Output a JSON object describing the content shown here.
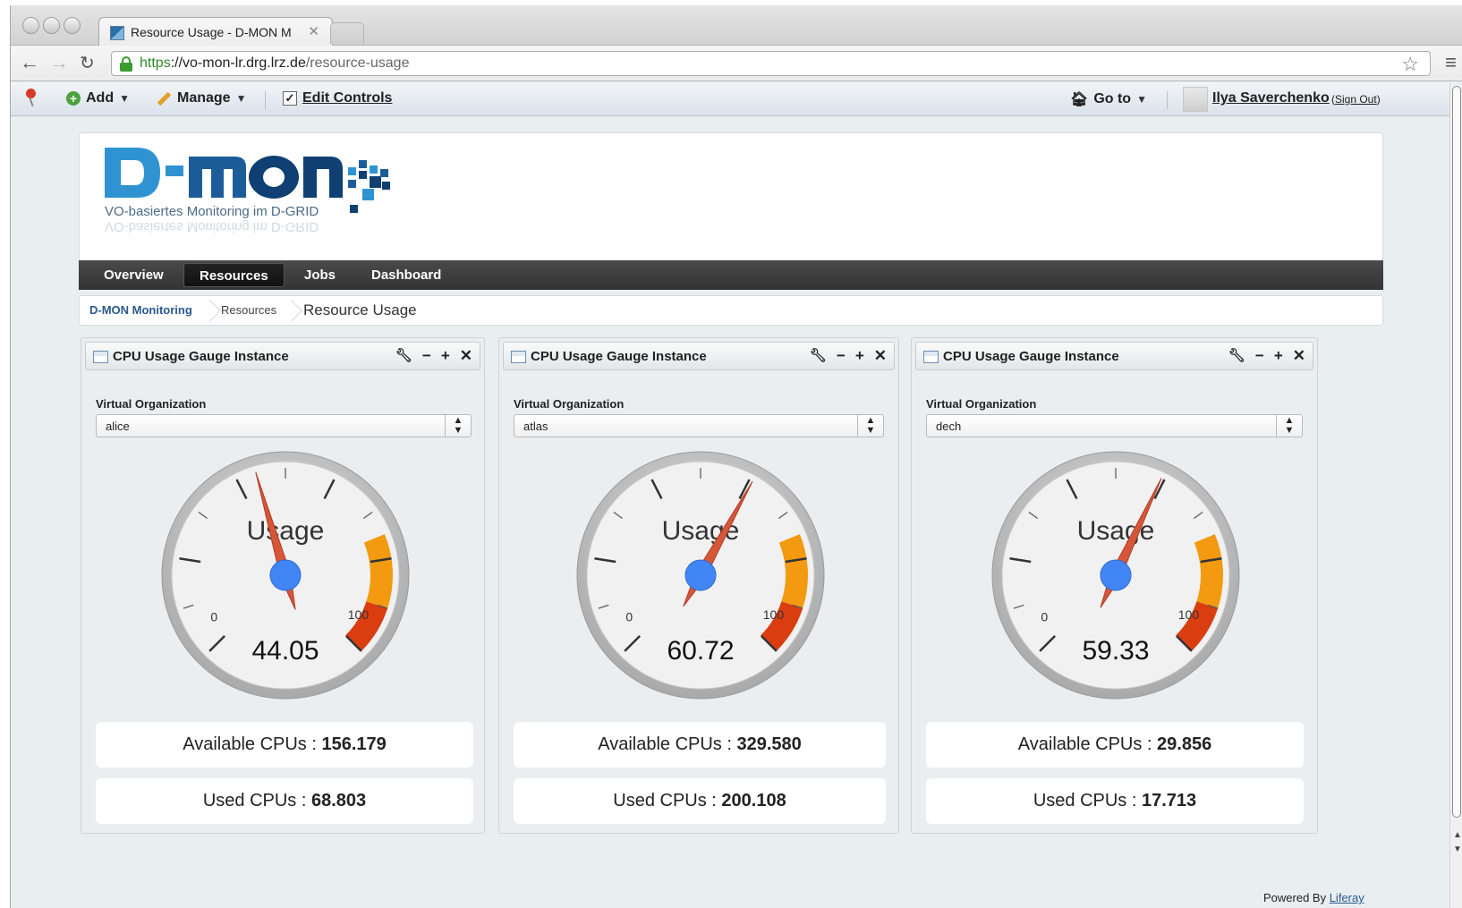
{
  "browser": {
    "tab_title": "Resource Usage - D-MON M",
    "url_scheme": "https",
    "url_host": "://vo-mon-lr.drg.lrz.de",
    "url_path": "/resource-usage"
  },
  "dockbar": {
    "add_label": "Add",
    "manage_label": "Manage",
    "edit_controls_label": "Edit Controls",
    "goto_label": "Go to",
    "user_name": "Ilya Saverchenko",
    "sign_out_label": "Sign Out"
  },
  "logo": {
    "text": "D-MON",
    "tagline": "VO-basiertes Monitoring im D-GRID"
  },
  "navigation": {
    "items": [
      {
        "label": "Overview"
      },
      {
        "label": "Resources"
      },
      {
        "label": "Jobs"
      },
      {
        "label": "Dashboard"
      }
    ],
    "active": "Resources"
  },
  "breadcrumb": [
    {
      "label": "D-MON Monitoring"
    },
    {
      "label": "Resources"
    },
    {
      "label": "Resource Usage"
    }
  ],
  "portlets": [
    {
      "title": "CPU Usage Gauge Instance",
      "vo_label": "Virtual Organization",
      "vo_value": "alice",
      "gauge": {
        "label": "Usage",
        "value": 44.05,
        "value_text": "44.05",
        "min": 0,
        "max": 100
      },
      "available_label": "Available CPUs : ",
      "available_value": "156.179",
      "used_label": "Used CPUs : ",
      "used_value": "68.803"
    },
    {
      "title": "CPU Usage Gauge Instance",
      "vo_label": "Virtual Organization",
      "vo_value": "atlas",
      "gauge": {
        "label": "Usage",
        "value": 60.72,
        "value_text": "60.72",
        "min": 0,
        "max": 100
      },
      "available_label": "Available CPUs : ",
      "available_value": "329.580",
      "used_label": "Used CPUs : ",
      "used_value": "200.108"
    },
    {
      "title": "CPU Usage Gauge Instance",
      "vo_label": "Virtual Organization",
      "vo_value": "dech",
      "gauge": {
        "label": "Usage",
        "value": 59.33,
        "value_text": "59.33",
        "min": 0,
        "max": 100
      },
      "available_label": "Available CPUs : ",
      "available_value": "29.856",
      "used_label": "Used CPUs : ",
      "used_value": "17.713"
    }
  ],
  "gauge_style": {
    "yellow_color": "#f39a10",
    "red_color": "#d93d10",
    "needle_color": "#d6563a",
    "hub_color": "#4285f4"
  },
  "footer": {
    "powered_by": "Powered By ",
    "powered_link": "Liferay"
  }
}
